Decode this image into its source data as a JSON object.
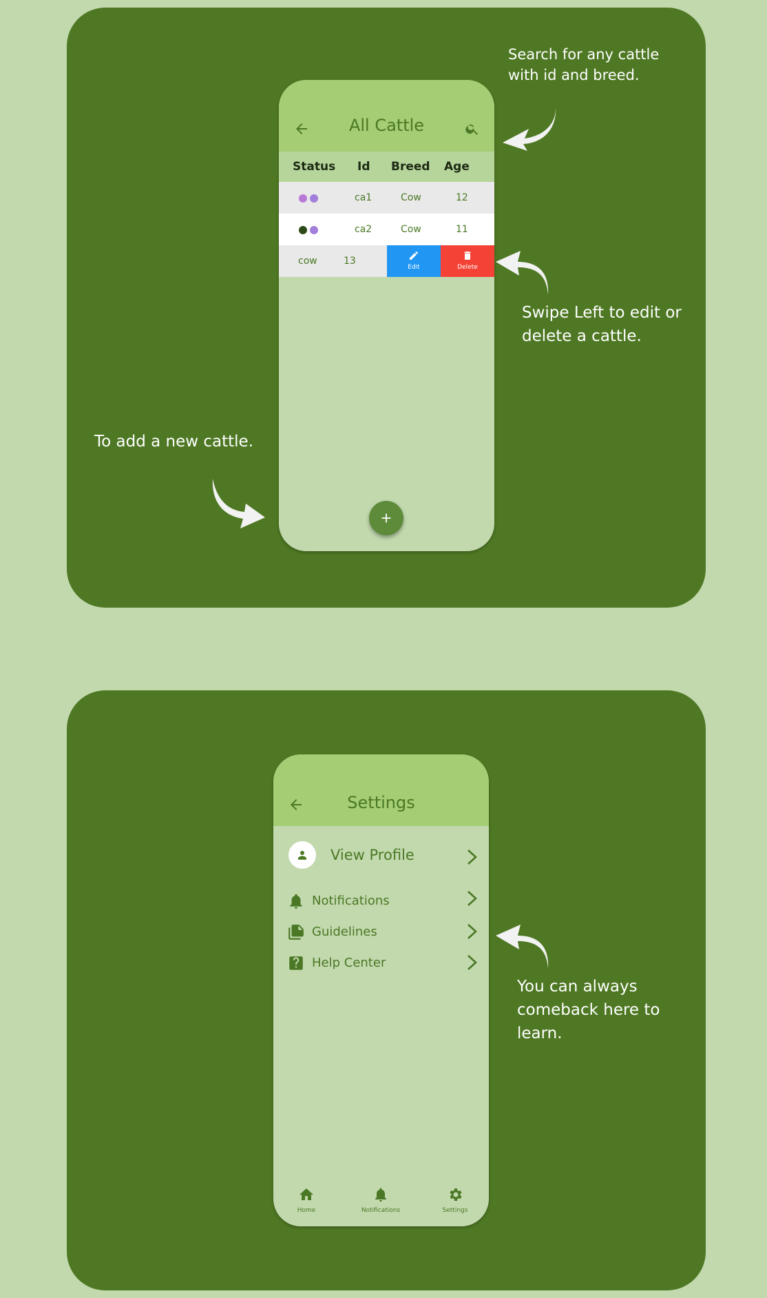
{
  "colors": {
    "background": "#c2d9ae",
    "panel": "#4e7823",
    "phone_bg": "#c2d9ae",
    "appbar": "#a5cd74",
    "accent": "#4a7824",
    "edit": "#2196f3",
    "delete": "#f44336",
    "annotation_text": "#ffffff"
  },
  "cattle_screen": {
    "title": "All Cattle",
    "back_icon": "arrow-left-icon",
    "search_icon": "search-icon",
    "columns": [
      "Status",
      "Id",
      "Breed",
      "Age"
    ],
    "rows": [
      {
        "status": [
          "purple-dot",
          "purple-dot"
        ],
        "id": "ca1",
        "breed": "Cow",
        "age": "12"
      },
      {
        "status": [
          "dark-green-dot",
          "purple-dot"
        ],
        "id": "ca2",
        "breed": "Cow",
        "age": "11"
      }
    ],
    "swiped_row": {
      "breed": "cow",
      "age": "13",
      "edit_label": "Edit",
      "delete_label": "Delete"
    },
    "fab_icon": "plus-icon"
  },
  "annotations": {
    "search": "Search for any cattle\nwith id and breed.",
    "swipe": "Swipe Left to edit or\n delete a cattle.",
    "add": "To add a new cattle.",
    "learn": "You can always\ncomeback here to\nlearn."
  },
  "settings_screen": {
    "title": "Settings",
    "back_icon": "arrow-left-icon",
    "profile_label": "View Profile",
    "items": [
      {
        "label": "Notifications",
        "icon": "bell-icon"
      },
      {
        "label": "Guidelines",
        "icon": "documents-icon"
      },
      {
        "label": "Help Center",
        "icon": "help-box-icon"
      }
    ],
    "nav": [
      {
        "label": "Home",
        "icon": "home-icon"
      },
      {
        "label": "Notifications",
        "icon": "bell-icon"
      },
      {
        "label": "Settings",
        "icon": "gear-icon"
      }
    ]
  }
}
